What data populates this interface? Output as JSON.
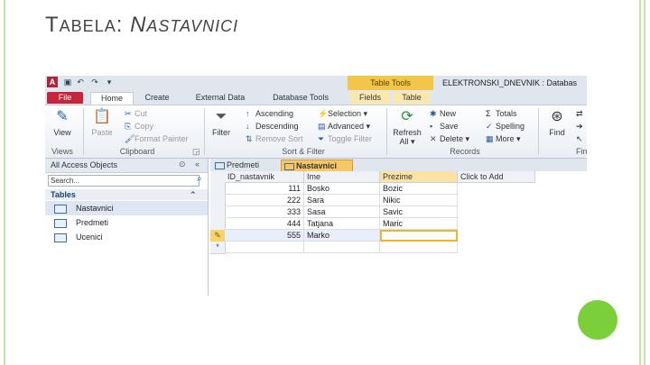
{
  "slide": {
    "title_initial": "T",
    "title_rest": "ABELA",
    "title_colon": ": ",
    "title_word_initial": "N",
    "title_word_rest": "ASTAVNICI"
  },
  "titlebar": {
    "app_letter": "A",
    "table_tools": "Table Tools",
    "window_title": "ELEKTRONSKI_DNEVNIK : Databas"
  },
  "tabs": [
    "File",
    "Home",
    "Create",
    "External Data",
    "Database Tools",
    "Fields",
    "Table"
  ],
  "ribbon": {
    "views": {
      "view": "View",
      "group": "Views"
    },
    "clipboard": {
      "paste": "Paste",
      "cut": "Cut",
      "copy": "Copy",
      "format_painter": "Format Painter",
      "group": "Clipboard"
    },
    "sort_filter": {
      "filter": "Filter",
      "ascending": "Ascending",
      "descending": "Descending",
      "remove_sort": "Remove Sort",
      "selection": "Selection ▾",
      "advanced": "Advanced ▾",
      "toggle_filter": "Toggle Filter",
      "group": "Sort & Filter"
    },
    "records": {
      "refresh": "Refresh",
      "refresh_sub": "All ▾",
      "new": "New",
      "save": "Save",
      "delete": "Delete ▾",
      "totals": "Totals",
      "spelling": "Spelling",
      "more": "More ▾",
      "group": "Records"
    },
    "find": {
      "find": "Find",
      "group": "Fin"
    }
  },
  "nav": {
    "header": "All Access Objects",
    "search_placeholder": "Search...",
    "section": "Tables",
    "items": [
      "Nastavnici",
      "Predmeti",
      "Ucenici"
    ]
  },
  "document": {
    "tabs": [
      "Predmeti",
      "Nastavnici"
    ],
    "columns": [
      "ID_nastavnik",
      "Ime",
      "Prezime",
      "Click to Add"
    ],
    "rows": [
      {
        "id": "111",
        "ime": "Bosko",
        "prezime": "Bozic"
      },
      {
        "id": "222",
        "ime": "Sara",
        "prezime": "Nikic"
      },
      {
        "id": "333",
        "ime": "Sasa",
        "prezime": "Savic"
      },
      {
        "id": "444",
        "ime": "Tatjana",
        "prezime": "Maric"
      },
      {
        "id": "555",
        "ime": "Marko",
        "prezime": ""
      }
    ],
    "new_row_marker": "*",
    "edit_marker": "✎"
  }
}
